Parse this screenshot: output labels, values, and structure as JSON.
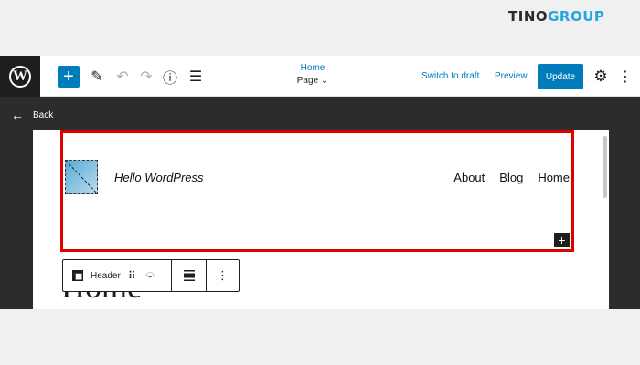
{
  "brand": {
    "part1": "TINO",
    "part2": "GROUP"
  },
  "toolbar": {
    "document_title": "Home",
    "document_type": "Page",
    "switch_to_draft": "Switch to draft",
    "preview": "Preview",
    "update": "Update",
    "icons": {
      "wp": "W",
      "add": "+",
      "pen": "✎",
      "undo": "↶",
      "redo": "↷",
      "info": "ⓘ",
      "list": "☰",
      "gear": "⚙",
      "more": "⋮",
      "chevron": "⌄"
    }
  },
  "canvas": {
    "back_arrow": "←",
    "back_label": "Back"
  },
  "header_block": {
    "site_title": "Hello WordPress",
    "nav": [
      "About",
      "Blog",
      "Home"
    ],
    "inserter": "+",
    "highlight_color": "#e10000"
  },
  "page_heading": "Home",
  "block_toolbar": {
    "label": "Header",
    "drag": "⠿",
    "move_up": "︿",
    "move_down": "﹀",
    "align": "☰",
    "more": "⋮"
  },
  "colors": {
    "accent": "#007cba",
    "dark": "#1e1e1e",
    "canvas_bg": "#2c2c2c"
  }
}
